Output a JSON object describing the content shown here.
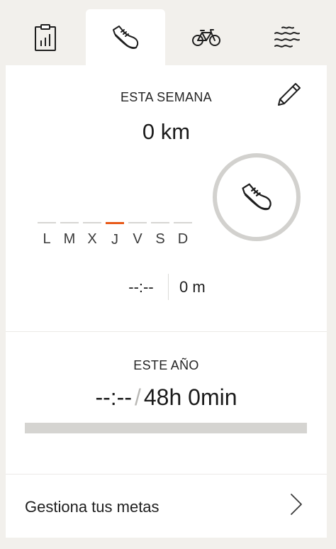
{
  "tabs": [
    {
      "icon": "clipboard-chart-icon",
      "active": false
    },
    {
      "icon": "running-shoe-icon",
      "active": true
    },
    {
      "icon": "bicycle-icon",
      "active": false
    },
    {
      "icon": "waves-icon",
      "active": false
    }
  ],
  "week": {
    "title": "ESTA SEMANA",
    "distance": "0 km",
    "days": [
      "L",
      "M",
      "X",
      "J",
      "V",
      "S",
      "D"
    ],
    "today_index": 3,
    "time": "--:--",
    "elevation": "0 m",
    "progress_ring": 0
  },
  "year": {
    "title": "ESTE AÑO",
    "current": "--:--",
    "separator": "/",
    "goal": "48h 0min",
    "progress": 0
  },
  "manage": {
    "label": "Gestiona tus metas"
  },
  "colors": {
    "accent": "#e85a1a",
    "track": "#d5d4d1",
    "background": "#f2f0ec"
  }
}
